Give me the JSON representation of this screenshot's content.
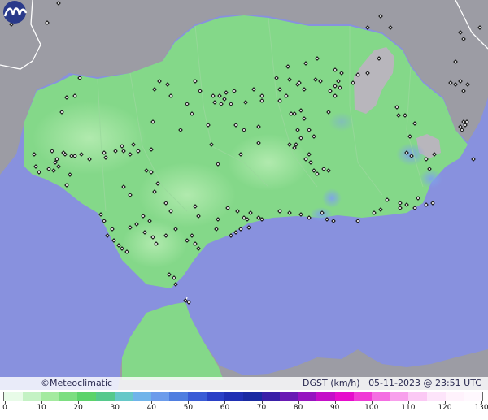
{
  "map": {
    "brand": "©Meteoclimatic",
    "variable": "DGST (km/h)",
    "datetime": "05-11-2023 @ 23:51 UTC",
    "colors": {
      "sea": "#8891de",
      "land_outside": "#9c9ca4",
      "andalusia_base": "#84d889",
      "andalusia_light": "#a4e6a3",
      "relief_gray": "#b6b6bc",
      "blue_patch": "#8ab2e8",
      "station": "#111111"
    }
  },
  "legend": {
    "ticks": [
      "0",
      "10",
      "20",
      "30",
      "40",
      "50",
      "60",
      "70",
      "80",
      "90",
      "100",
      "110",
      "120",
      "130"
    ],
    "colors": [
      "#e8fbe8",
      "#c4f2c4",
      "#a4ea9f",
      "#7cde80",
      "#5cd36a",
      "#56c98c",
      "#66c8c8",
      "#70b4ea",
      "#6c9ceb",
      "#4f7ee0",
      "#3a5cd6",
      "#2a40c6",
      "#2030b4",
      "#1a2aa2",
      "#3a20a8",
      "#6a1ab4",
      "#9614c0",
      "#c40ec8",
      "#e60ccc",
      "#f03ad6",
      "#f46ee2",
      "#f8a0ec",
      "#fbc8f4",
      "#fde4fa",
      "#fff2fc",
      "#fff8fe"
    ]
  }
}
